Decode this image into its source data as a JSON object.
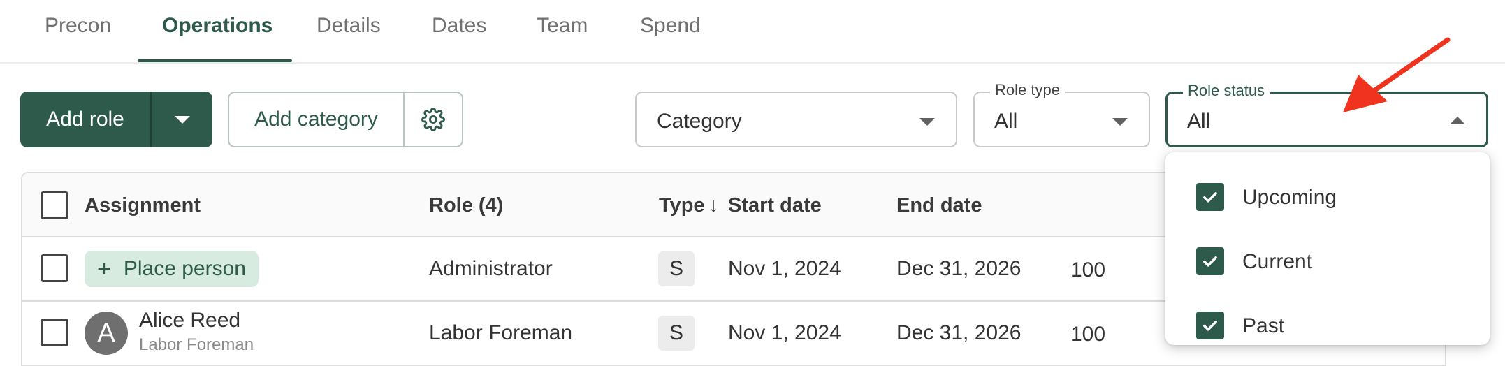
{
  "tabs": [
    {
      "label": "Precon",
      "active": false
    },
    {
      "label": "Operations",
      "active": true
    },
    {
      "label": "Details",
      "active": false
    },
    {
      "label": "Dates",
      "active": false
    },
    {
      "label": "Team",
      "active": false
    },
    {
      "label": "Spend",
      "active": false
    }
  ],
  "toolbar": {
    "add_role_label": "Add role",
    "add_category_label": "Add category"
  },
  "filters": {
    "category": {
      "value": "Category"
    },
    "role_type": {
      "label": "Role type",
      "value": "All"
    },
    "role_status": {
      "label": "Role status",
      "value": "All",
      "open": true
    }
  },
  "status_menu": {
    "options": [
      {
        "label": "Upcoming",
        "checked": true
      },
      {
        "label": "Current",
        "checked": true
      },
      {
        "label": "Past",
        "checked": true
      }
    ]
  },
  "table": {
    "headers": {
      "assignment": "Assignment",
      "role": "Role (4)",
      "type": "Type",
      "sort_arrow": "↓",
      "start_date": "Start date",
      "end_date": "End date"
    },
    "rows": [
      {
        "assignment_action": "Place person",
        "role": "Administrator",
        "type": "S",
        "start": "Nov 1, 2024",
        "end": "Dec 31, 2026",
        "value": "100"
      },
      {
        "avatar_initial": "A",
        "name": "Alice Reed",
        "subtitle": "Labor Foreman",
        "role": "Labor Foreman",
        "type": "S",
        "start": "Nov 1, 2024",
        "end": "Dec 31, 2026",
        "value": "100"
      }
    ]
  },
  "colors": {
    "accent": "#2e5a4b",
    "chip_bg": "#d8ebe0",
    "annotation_arrow": "#f0331f"
  }
}
